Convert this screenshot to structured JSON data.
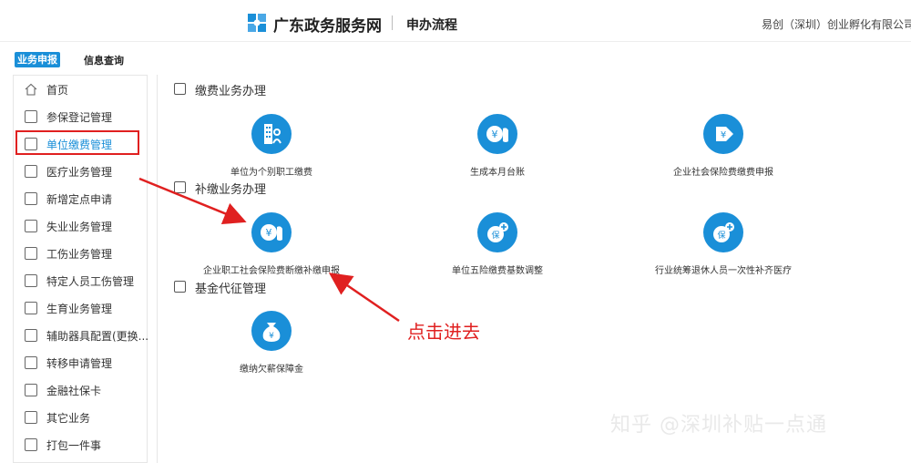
{
  "header": {
    "site_title": "广东政务服务网",
    "page_subtitle": "申办流程",
    "company": "易创（深圳）创业孵化有限公司"
  },
  "tabs": [
    {
      "label": "业务申报",
      "active": true
    },
    {
      "label": "信息查询",
      "active": false
    }
  ],
  "sidebar": {
    "items": [
      {
        "label": "首页",
        "icon": "home-icon"
      },
      {
        "label": "参保登记管理",
        "icon": "doc-icon"
      },
      {
        "label": "单位缴费管理",
        "icon": "form-icon",
        "active": true
      },
      {
        "label": "医疗业务管理",
        "icon": "doc-icon"
      },
      {
        "label": "新增定点申请",
        "icon": "building-icon"
      },
      {
        "label": "失业业务管理",
        "icon": "yuan-doc-icon"
      },
      {
        "label": "工伤业务管理",
        "icon": "id-card-icon"
      },
      {
        "label": "特定人员工伤管理",
        "icon": "doc-icon"
      },
      {
        "label": "生育业务管理",
        "icon": "yuan-doc-icon"
      },
      {
        "label": "辅助器具配置(更换...",
        "icon": "doc-icon"
      },
      {
        "label": "转移申请管理",
        "icon": "building-icon"
      },
      {
        "label": "金融社保卡",
        "icon": "doc-icon"
      },
      {
        "label": "其它业务",
        "icon": "building-icon"
      },
      {
        "label": "打包一件事",
        "icon": "building-icon"
      }
    ]
  },
  "sections": [
    {
      "title": "缴费业务办理",
      "services": [
        {
          "label": "单位为个别职工缴费",
          "icon": "building-person-icon"
        },
        {
          "label": "生成本月台账",
          "icon": "yuan-bag-icon"
        },
        {
          "label": "企业社会保险费缴费申报",
          "icon": "yuan-tag-icon"
        }
      ]
    },
    {
      "title": "补缴业务办理",
      "services": [
        {
          "label": "企业职工社会保险费断缴补缴申报",
          "icon": "yuan-bag-icon"
        },
        {
          "label": "单位五险缴费基数调整",
          "icon": "insurance-plus-icon"
        },
        {
          "label": "行业统筹退休人员一次性补齐医疗",
          "icon": "insurance-plus-icon"
        }
      ]
    },
    {
      "title": "基金代征管理",
      "services": [
        {
          "label": "缴纳欠薪保障金",
          "icon": "money-bag-icon"
        }
      ]
    }
  ],
  "annotation": {
    "callout": "点击进去",
    "color": "#e02020"
  },
  "watermark": "知乎 @深圳补贴一点通",
  "colors": {
    "accent": "#1a8fd8",
    "highlight": "#e02020"
  }
}
